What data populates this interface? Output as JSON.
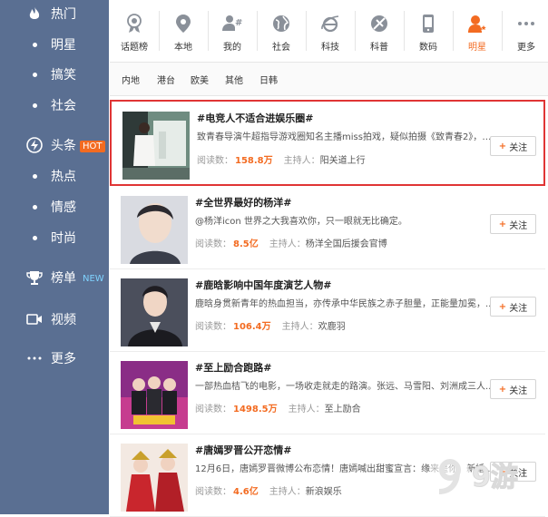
{
  "sidebar": {
    "items": [
      {
        "label": "热门",
        "icon": "fire-icon"
      },
      {
        "label": "明星"
      },
      {
        "label": "搞笑"
      },
      {
        "label": "社会"
      },
      {
        "label": "头条",
        "icon": "lightning-icon",
        "badge": "HOT"
      },
      {
        "label": "热点"
      },
      {
        "label": "情感"
      },
      {
        "label": "时尚"
      },
      {
        "label": "榜单",
        "icon": "trophy-icon",
        "badge": "NEW"
      },
      {
        "label": "视频",
        "icon": "video-icon"
      },
      {
        "label": "更多",
        "icon": "more-dots-icon"
      }
    ]
  },
  "categories": [
    {
      "label": "话题榜",
      "icon": "medal-icon"
    },
    {
      "label": "本地",
      "icon": "location-pin-icon"
    },
    {
      "label": "我的",
      "icon": "user-hash-icon"
    },
    {
      "label": "社会",
      "icon": "globe-icon"
    },
    {
      "label": "科技",
      "icon": "ie-browser-icon"
    },
    {
      "label": "科普",
      "icon": "satellite-icon"
    },
    {
      "label": "数码",
      "icon": "phone-icon"
    },
    {
      "label": "明星",
      "icon": "star-person-icon",
      "active": true
    },
    {
      "label": "更多",
      "icon": "more-dots-icon"
    }
  ],
  "subtabs": [
    "内地",
    "港台",
    "欧美",
    "其他",
    "日韩"
  ],
  "labels": {
    "reads": "阅读数：",
    "host": "主持人：",
    "follow": "关注"
  },
  "feed": [
    {
      "title": "#电竞人不适合进娱乐圈#",
      "desc": "致青春导演牛超指导游戏圈知名主播miss拍戏，疑似拍摄《致青春2》，从...",
      "reads": "158.8万",
      "host": "阳关道上行"
    },
    {
      "title": "#全世界最好的杨洋#",
      "desc": "@杨洋icon 世界之大我喜欢你，只一眼就无比确定。",
      "reads": "8.5亿",
      "host": "杨洋全国后援会官博"
    },
    {
      "title": "#鹿晗影响中国年度演艺人物#",
      "desc": "鹿晗身贯新青年的热血担当，亦传承中华民族之赤子胆量，正能量加冕，...",
      "reads": "106.4万",
      "host": "欢鹿羽"
    },
    {
      "title": "#至上励合跑路#",
      "desc": "一部热血桔飞的电影，一场收走就走的路演。张远、马雪阳、刘洲成三人...",
      "reads": "1498.5万",
      "host": "至上励合"
    },
    {
      "title": "#唐嫣罗晋公开恋情#",
      "desc": "12月6日，唐嫣罗晋微博公布恋情！唐嫣喊出甜蜜宣言：缘来是你。新婚...",
      "reads": "4.6亿",
      "host": "新浪娱乐"
    }
  ],
  "watermark": "9游",
  "colors": {
    "sidebar": "#5a6f92",
    "accent": "#f36b21",
    "highlight": "#e03535"
  }
}
